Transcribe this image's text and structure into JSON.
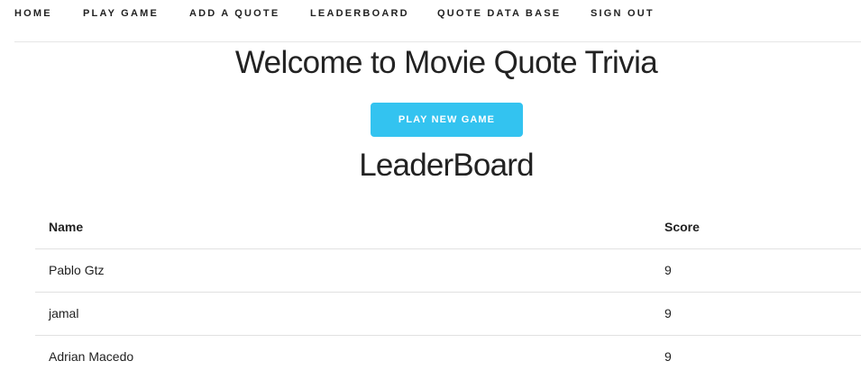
{
  "nav": {
    "items": [
      {
        "label": "HOME"
      },
      {
        "label": "PLAY GAME"
      },
      {
        "label": "ADD A QUOTE"
      },
      {
        "label": "LEADERBOARD"
      },
      {
        "label": "QUOTE DATA BASE"
      },
      {
        "label": "SIGN OUT"
      }
    ]
  },
  "main": {
    "title": "Welcome to Movie Quote Trivia",
    "play_button_label": "PLAY NEW GAME",
    "leaderboard_title": "LeaderBoard"
  },
  "leaderboard": {
    "columns": {
      "name": "Name",
      "score": "Score"
    },
    "rows": [
      {
        "name": "Pablo Gtz",
        "score": "9"
      },
      {
        "name": "jamal",
        "score": "9"
      },
      {
        "name": "Adrian Macedo",
        "score": "9"
      }
    ]
  },
  "colors": {
    "accent": "#33c3f0",
    "text": "#222222",
    "divider": "#e1e1e1"
  }
}
